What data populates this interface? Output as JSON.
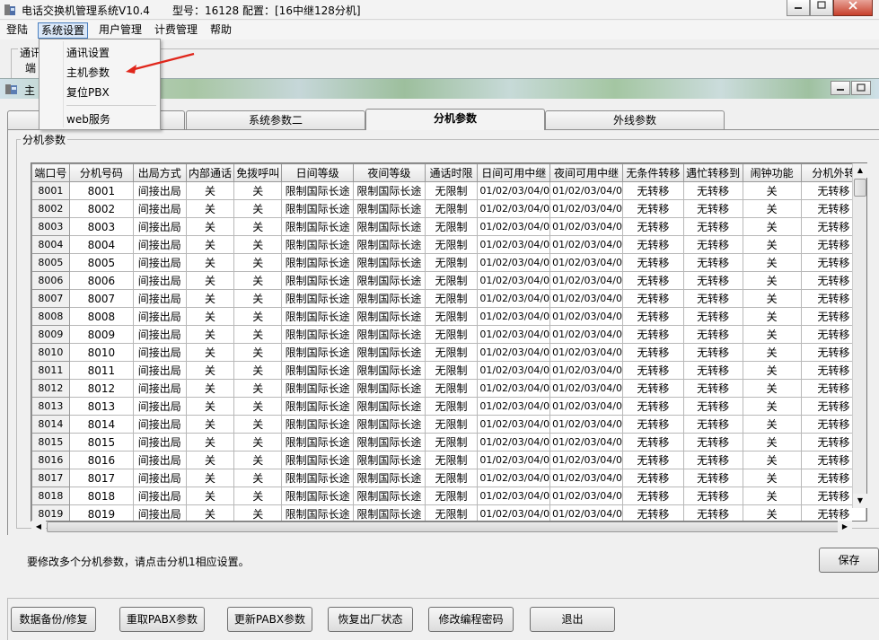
{
  "window": {
    "app_title": "电话交换机管理系统V10.4",
    "model": "型号：16128",
    "config": "配置：[16中继128分机]"
  },
  "menubar": [
    "登陆",
    "系统设置",
    "用户管理",
    "计费管理",
    "帮助"
  ],
  "dropdown": [
    "通讯设置",
    "主机参数",
    "复位PBX",
    "web服务"
  ],
  "under_layer": {
    "group_label": "通讯",
    "field_label": "端"
  },
  "child_window": {
    "title": "主"
  },
  "tabs": [
    "",
    "系统参数二",
    "分机参数",
    "外线参数"
  ],
  "active_tab": "分机参数",
  "group_title": "分机参数",
  "table": {
    "columns": [
      "端口号",
      "分机号码",
      "出局方式",
      "内部通话",
      "免拨呼叫",
      "日间等级",
      "夜间等级",
      "通话时限",
      "日间可用中继",
      "夜间可用中继",
      "无条件转移",
      "遇忙转移到",
      "闹钟功能",
      "分机外转"
    ],
    "rows": [
      [
        "8001",
        "8001",
        "间接出局",
        "关",
        "关",
        "限制国际长途",
        "限制国际长途",
        "无限制",
        "01/02/03/04/0",
        "01/02/03/04/0",
        "无转移",
        "无转移",
        "关",
        "无转移"
      ],
      [
        "8002",
        "8002",
        "间接出局",
        "关",
        "关",
        "限制国际长途",
        "限制国际长途",
        "无限制",
        "01/02/03/04/0",
        "01/02/03/04/0",
        "无转移",
        "无转移",
        "关",
        "无转移"
      ],
      [
        "8003",
        "8003",
        "间接出局",
        "关",
        "关",
        "限制国际长途",
        "限制国际长途",
        "无限制",
        "01/02/03/04/0",
        "01/02/03/04/0",
        "无转移",
        "无转移",
        "关",
        "无转移"
      ],
      [
        "8004",
        "8004",
        "间接出局",
        "关",
        "关",
        "限制国际长途",
        "限制国际长途",
        "无限制",
        "01/02/03/04/0",
        "01/02/03/04/0",
        "无转移",
        "无转移",
        "关",
        "无转移"
      ],
      [
        "8005",
        "8005",
        "间接出局",
        "关",
        "关",
        "限制国际长途",
        "限制国际长途",
        "无限制",
        "01/02/03/04/0",
        "01/02/03/04/0",
        "无转移",
        "无转移",
        "关",
        "无转移"
      ],
      [
        "8006",
        "8006",
        "间接出局",
        "关",
        "关",
        "限制国际长途",
        "限制国际长途",
        "无限制",
        "01/02/03/04/0",
        "01/02/03/04/0",
        "无转移",
        "无转移",
        "关",
        "无转移"
      ],
      [
        "8007",
        "8007",
        "间接出局",
        "关",
        "关",
        "限制国际长途",
        "限制国际长途",
        "无限制",
        "01/02/03/04/0",
        "01/02/03/04/0",
        "无转移",
        "无转移",
        "关",
        "无转移"
      ],
      [
        "8008",
        "8008",
        "间接出局",
        "关",
        "关",
        "限制国际长途",
        "限制国际长途",
        "无限制",
        "01/02/03/04/0",
        "01/02/03/04/0",
        "无转移",
        "无转移",
        "关",
        "无转移"
      ],
      [
        "8009",
        "8009",
        "间接出局",
        "关",
        "关",
        "限制国际长途",
        "限制国际长途",
        "无限制",
        "01/02/03/04/0",
        "01/02/03/04/0",
        "无转移",
        "无转移",
        "关",
        "无转移"
      ],
      [
        "8010",
        "8010",
        "间接出局",
        "关",
        "关",
        "限制国际长途",
        "限制国际长途",
        "无限制",
        "01/02/03/04/0",
        "01/02/03/04/0",
        "无转移",
        "无转移",
        "关",
        "无转移"
      ],
      [
        "8011",
        "8011",
        "间接出局",
        "关",
        "关",
        "限制国际长途",
        "限制国际长途",
        "无限制",
        "01/02/03/04/0",
        "01/02/03/04/0",
        "无转移",
        "无转移",
        "关",
        "无转移"
      ],
      [
        "8012",
        "8012",
        "间接出局",
        "关",
        "关",
        "限制国际长途",
        "限制国际长途",
        "无限制",
        "01/02/03/04/0",
        "01/02/03/04/0",
        "无转移",
        "无转移",
        "关",
        "无转移"
      ],
      [
        "8013",
        "8013",
        "间接出局",
        "关",
        "关",
        "限制国际长途",
        "限制国际长途",
        "无限制",
        "01/02/03/04/0",
        "01/02/03/04/0",
        "无转移",
        "无转移",
        "关",
        "无转移"
      ],
      [
        "8014",
        "8014",
        "间接出局",
        "关",
        "关",
        "限制国际长途",
        "限制国际长途",
        "无限制",
        "01/02/03/04/0",
        "01/02/03/04/0",
        "无转移",
        "无转移",
        "关",
        "无转移"
      ],
      [
        "8015",
        "8015",
        "间接出局",
        "关",
        "关",
        "限制国际长途",
        "限制国际长途",
        "无限制",
        "01/02/03/04/0",
        "01/02/03/04/0",
        "无转移",
        "无转移",
        "关",
        "无转移"
      ],
      [
        "8016",
        "8016",
        "间接出局",
        "关",
        "关",
        "限制国际长途",
        "限制国际长途",
        "无限制",
        "01/02/03/04/0",
        "01/02/03/04/0",
        "无转移",
        "无转移",
        "关",
        "无转移"
      ],
      [
        "8017",
        "8017",
        "间接出局",
        "关",
        "关",
        "限制国际长途",
        "限制国际长途",
        "无限制",
        "01/02/03/04/0",
        "01/02/03/04/0",
        "无转移",
        "无转移",
        "关",
        "无转移"
      ],
      [
        "8018",
        "8018",
        "间接出局",
        "关",
        "关",
        "限制国际长途",
        "限制国际长途",
        "无限制",
        "01/02/03/04/0",
        "01/02/03/04/0",
        "无转移",
        "无转移",
        "关",
        "无转移"
      ],
      [
        "8019",
        "8019",
        "间接出局",
        "关",
        "关",
        "限制国际长途",
        "限制国际长途",
        "无限制",
        "01/02/03/04/0",
        "01/02/03/04/0",
        "无转移",
        "无转移",
        "关",
        "无转移"
      ]
    ]
  },
  "hint_text": "要修改多个分机参数，请点击分机1相应设置。",
  "save_label": "保存",
  "bottom_buttons": [
    "数据备份/修复",
    "重取PABX参数",
    "更新PABX参数",
    "恢复出厂状态",
    "修改编程密码",
    "退出"
  ],
  "colors": {
    "annotation_arrow": "#e0261b",
    "menu_highlight": "#dbe8f8"
  }
}
